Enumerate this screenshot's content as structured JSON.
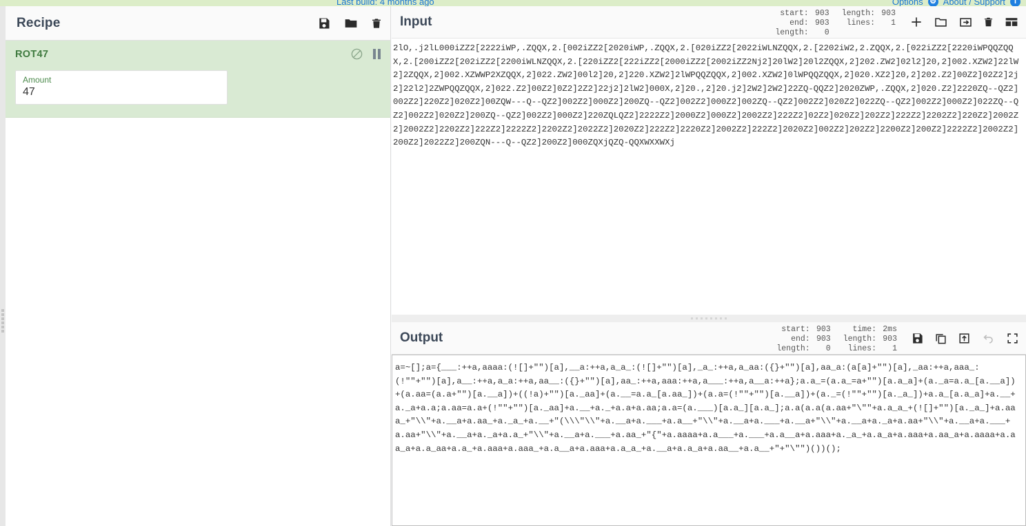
{
  "banner": {
    "build_text": "Last build: 4 months ago",
    "options_label": "Options",
    "options_icon": "gear-icon",
    "about_label": "About / Support",
    "about_icon": "info-icon"
  },
  "recipe": {
    "title": "Recipe",
    "icons": [
      "save-icon",
      "folder-icon",
      "trash-icon"
    ],
    "operations": [
      {
        "name": "ROT47",
        "disable_icon": "disable-icon",
        "breakpoint_icon": "pause-icon",
        "args": [
          {
            "label": "Amount",
            "value": "47"
          }
        ]
      }
    ]
  },
  "input": {
    "title": "Input",
    "meta": {
      "start_label": "start:",
      "start_value": "903",
      "end_label": "end:",
      "end_value": "903",
      "length_label": "length:",
      "length_value": "0",
      "length2_label": "length:",
      "length2_value": "903",
      "lines_label": "lines:",
      "lines_value": "1"
    },
    "icons": [
      "add-tab-icon",
      "folder-open-icon",
      "open-folder-as-input-icon",
      "clear-io-icon",
      "reset-pane-layout-icon"
    ],
    "text": "2lO,.j2lL000iZZ2[2222iWP,.ZQQX,2.[002iZZ2[2020iWP,.ZQQX,2.[020iZZ2[2022iWLNZQQX,2.[2202iW2,2.ZQQX,2.[022iZZ2[2220iWPQQZQQX,2.[200iZZ2[202iZZ2[2200iWLNZQQX,2.[220iZZ2[222iZZ2[2000iZZ2[2002iZZ2Nj2]20lW2]20l2ZQQX,2]202.ZW2]02l2]20,2]002.XZW2]22lW2]2ZQQX,2]002.XZWWP2XZQQX,2]022.ZW2]00l2]20,2]220.XZW2]2lWPQQZQQX,2]002.XZW2]0lWPQQZQQX,2]020.XZ2]20,2]202.Z2]00Z2]02Z2]2j2]22l2]2ZWPQQZQQX,2]022.Z2]00Z2]0Z2]2Z2]22j2]2lW2]000X,2]20.,2]20.j2]2W2]2W2]22ZQ-QQZ2]2020ZWP,.ZQQX,2]020.Z2]2220ZQ--QZ2]002Z2]220Z2]020Z2]00ZQW---Q--QZ2]002Z2]000Z2]200ZQ--QZ2]002Z2]000Z2]002ZQ--QZ2]002Z2]020Z2]022ZQ--QZ2]002Z2]000Z2]022ZQ--QZ2]002Z2]020Z2]200ZQ--QZ2]002Z2]000Z2]220ZQLQZ2]2222Z2]2000Z2]000Z2]2002Z2]222Z2]02Z2]020Z2]202Z2]222Z2]2202Z2]220Z2]2002Z2]2002Z2]2202Z2]222Z2]2222Z2]2202Z2]2022Z2]2020Z2]222Z2]2220Z2]2002Z2]222Z2]2020Z2]002Z2]202Z2]2200Z2]200Z2]2222Z2]2002Z2]200Z2]2022Z2]200ZQN---Q--QZ2]200Z2]000ZQXjQZQ-QQXWXXWXj"
  },
  "output": {
    "title": "Output",
    "meta": {
      "start_label": "start:",
      "start_value": "903",
      "end_label": "end:",
      "end_value": "903",
      "length_label": "length:",
      "length_value": "0",
      "time_label": "time:",
      "time_value": "2ms",
      "length2_label": "length:",
      "length2_value": "903",
      "lines_label": "lines:",
      "lines_value": "1"
    },
    "icons": [
      "save-output-icon",
      "copy-output-icon",
      "replace-input-icon",
      "undo-icon",
      "maximise-icon"
    ],
    "text": "a=~[];a={___:++a,aaaa:(![]+\"\")[a],__a:++a,a_a_:(![]+\"\")[a],_a_:++a,a_aa:({}+\"\")[a],aa_a:(a[a]+\"\")[a],_aa:++a,aaa_:(!\"\"+\"\")[a],a__:++a,a_a:++a,aa__:({}+\"\")[a],aa_:++a,aaa:++a,a___:++a,a__a:++a};a.a_=(a.a_=a+\"\")[a.a_a]+(a._a=a.a_[a.__a])+(a.aa=(a.a+\"\")[a.__a])+((!a)+\"\")[a._aa]+(a.__=a.a_[a.aa_])+(a.a=(!\"\"+\"\")[a.__a])+(a._=(!\"\"+\"\")[a._a_])+a.a_[a.a_a]+a.__+a._a+a.a;a.aa=a.a+(!\"\"+\"\")[a._aa]+a.__+a._+a.a+a.aa;a.a=(a.___)[a.a_][a.a_];a.a(a.a(a.aa+\"\\\"\"+a.a_a_+(![]+\"\")[a._a_]+a.aaa_+\"\\\\\"+a.__a+a.aa_+a._a_+a.__+\"(\\\\\\\"\\\\\"+a.__a+a.___+a.a__+\"\\\\\"+a.__a+a.___+a.__a+\"\\\\\"+a.__a+a._a+a.aa+\"\\\\\"+a.__a+a.___+a.aa+\"\\\\\"+a.__a+a._a+a.a_+\"\\\\\"+a.__a+a.___+a.aa_+\"{\"+a.aaaa+a.a___+a.___+a.a__a+a.aaa+a._a_+a.a_a+a.aaa+a.aa_a+a.aaaa+a.aa_a+a.a_aa+a.a_+a.aaa+a.aaa_+a.a__a+a.aaa+a.a_a_+a.__a+a.a_a+a.aa__+a.a__+\"+\"\\\"\")())();"
  }
}
